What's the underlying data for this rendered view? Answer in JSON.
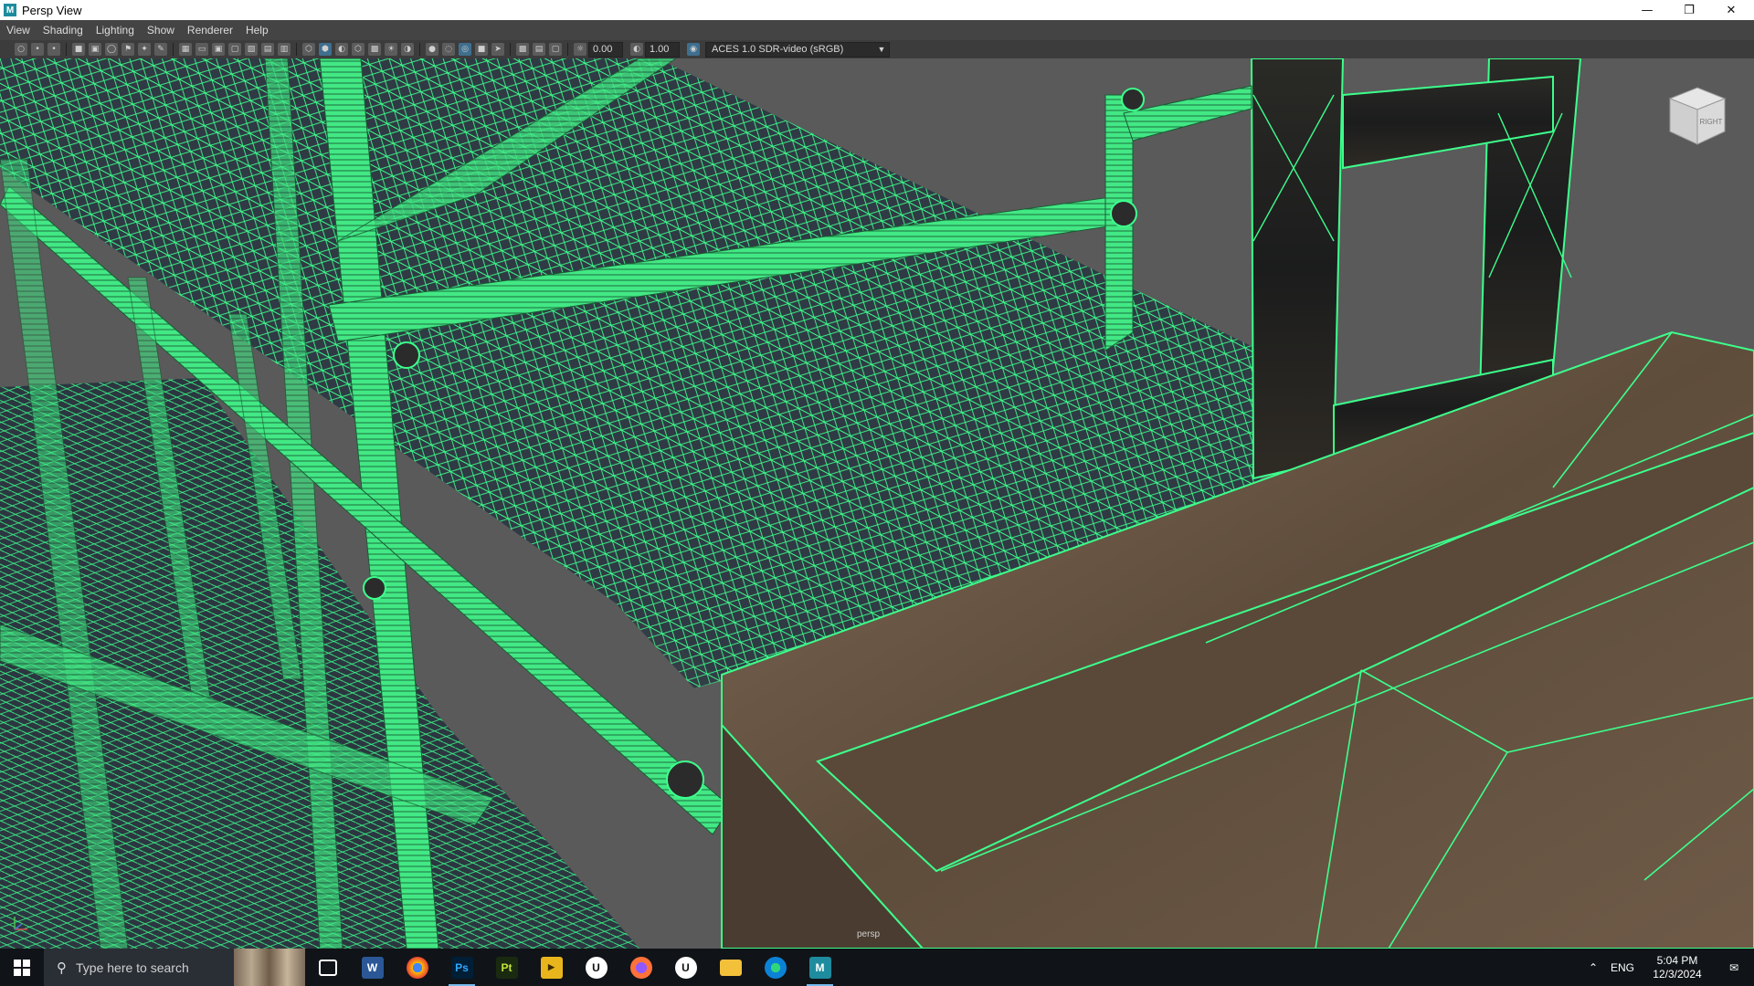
{
  "window": {
    "title": "Persp View",
    "icon": "maya-icon"
  },
  "menu": [
    "View",
    "Shading",
    "Lighting",
    "Show",
    "Renderer",
    "Help"
  ],
  "toolbar": {
    "exposure_value": "0.00",
    "gamma_value": "1.00",
    "color_management": "ACES 1.0 SDR-video (sRGB)"
  },
  "viewport": {
    "camera_label": "persp",
    "viewcube_face": "RIGHT"
  },
  "taskbar": {
    "search_placeholder": "Type here to search",
    "apps": [
      "Task View",
      "Word",
      "Chrome",
      "Photoshop",
      "Painter",
      "Player",
      "Unreal Engine",
      "Firefox",
      "Unreal Engine",
      "File Explorer",
      "Edge",
      "Maya"
    ],
    "language": "ENG",
    "time": "5:04 PM",
    "date": "12/3/2024"
  },
  "colors": {
    "wireframe": "#3dff8c",
    "viewport_bg": "#5a5a5a",
    "wood": "#6e5a47"
  }
}
